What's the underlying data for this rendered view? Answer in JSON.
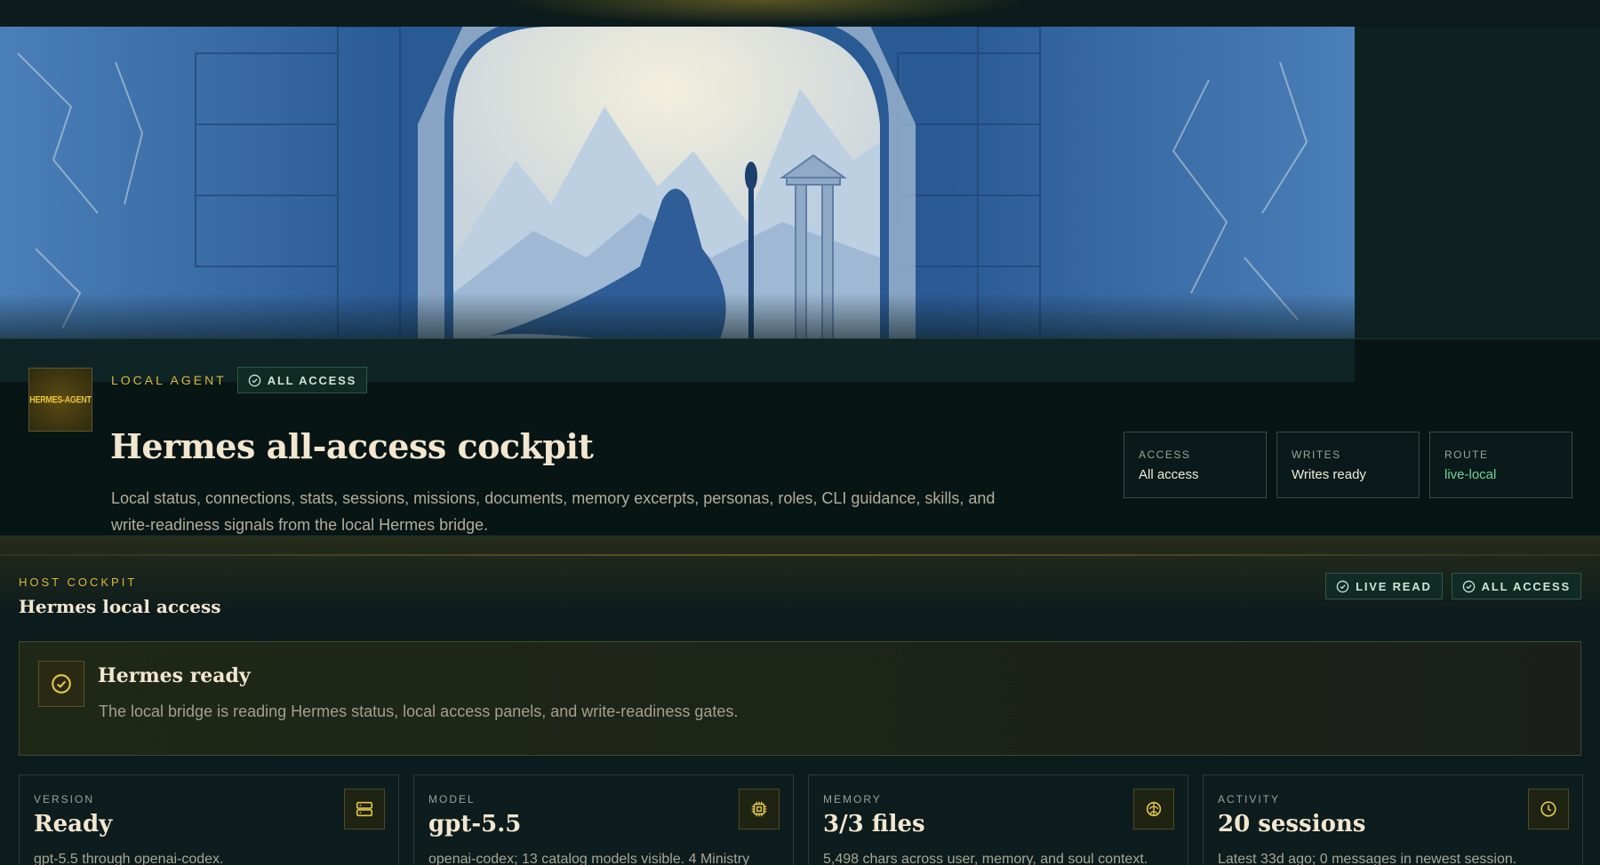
{
  "hero": {
    "logo_text": "HERMES-AGENT",
    "eyebrow": "LOCAL AGENT",
    "access_pill": "ALL ACCESS",
    "title": "Hermes all-access cockpit",
    "description": "Local status, connections, stats, sessions, missions, documents, memory excerpts, personas, roles, CLI guidance, skills, and write-readiness signals from the local Hermes bridge.",
    "stats": [
      {
        "label": "ACCESS",
        "value": "All access"
      },
      {
        "label": "WRITES",
        "value": "Writes ready"
      },
      {
        "label": "ROUTE",
        "value": "live-local"
      }
    ]
  },
  "section": {
    "eyebrow": "HOST COCKPIT",
    "title": "Hermes local access",
    "pills": [
      "LIVE READ",
      "ALL ACCESS"
    ],
    "ready": {
      "title": "Hermes ready",
      "description": "The local bridge is reading Hermes status, local access panels, and write-readiness gates."
    },
    "metrics": [
      {
        "label": "VERSION",
        "value": "Ready",
        "sub": "gpt-5.5 through openai-codex.",
        "icon": "server-icon"
      },
      {
        "label": "MODEL",
        "value": "gpt-5.5",
        "sub": "openai-codex; 13 catalog models visible. 4 Ministry",
        "icon": "chip-icon"
      },
      {
        "label": "MEMORY",
        "value": "3/3 files",
        "sub": "5,498 chars across user, memory, and soul context.",
        "icon": "brain-icon"
      },
      {
        "label": "ACTIVITY",
        "value": "20 sessions",
        "sub": "Latest 33d ago; 0 messages in newest session.",
        "icon": "clock-icon"
      }
    ]
  },
  "colors": {
    "accent_gold": "#d8b93c",
    "live_green": "#6fd39b",
    "background": "#0b1a1a"
  }
}
